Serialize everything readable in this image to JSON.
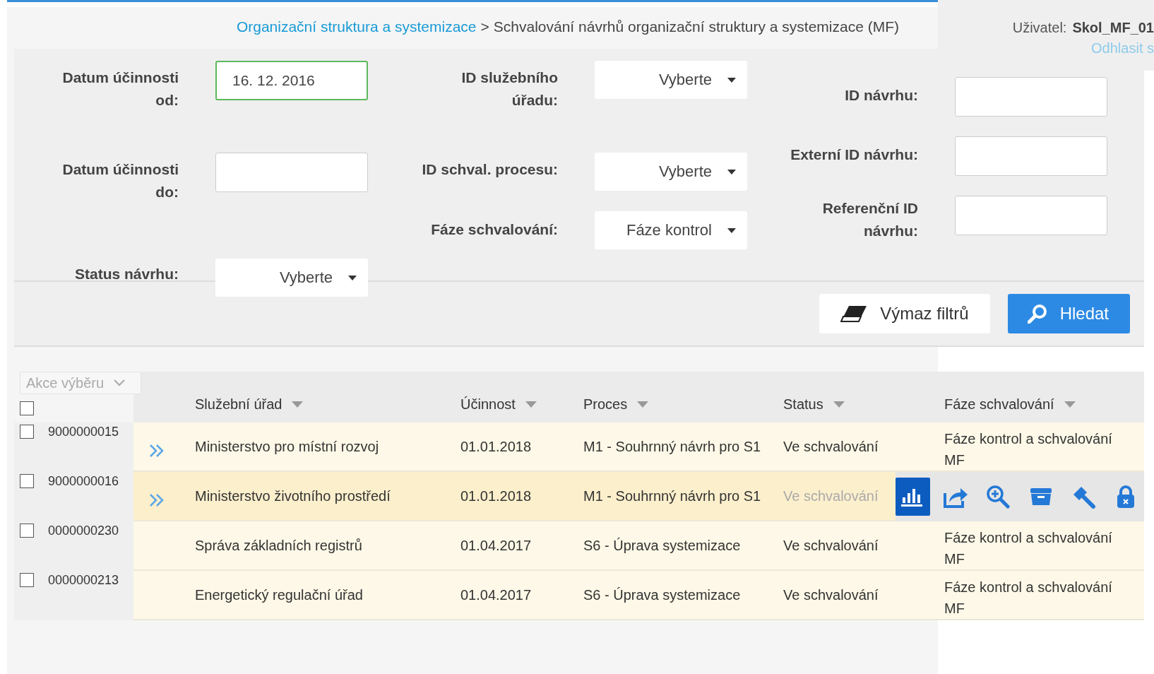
{
  "header": {
    "breadcrumb": {
      "link": "Organizační struktura a systemizace",
      "separator": ">",
      "current": "Schvalování návrhů organizační struktury a systemizace (MF)"
    },
    "user": {
      "label": "Uživatel:",
      "name": "Skol_MF_01",
      "logout": "Odhlasit s"
    }
  },
  "filters": {
    "columns": [
      {
        "fields": [
          {
            "kind": "date",
            "label": "Datum účinnosti od:",
            "value": "16. 12. 2016",
            "focused": true
          },
          {
            "kind": "date",
            "label": "Datum účinnosti do:",
            "focused": false
          },
          {
            "kind": "select",
            "label": "Status návrhu:",
            "value": "Vyberte"
          }
        ]
      },
      {
        "fields": [
          {
            "kind": "select",
            "label": "ID služebního úřadu:",
            "value": "Vyberte"
          },
          {
            "kind": "select",
            "label": "ID schval. procesu:",
            "value": "Vyberte"
          },
          {
            "kind": "select",
            "label": "Fáze schvalování:",
            "value": "Fáze kontrol"
          }
        ]
      },
      {
        "fields": [
          {
            "kind": "text",
            "label": "ID návrhu:",
            "focused": false
          },
          {
            "kind": "text",
            "label": "Externí ID návrhu:",
            "focused": false
          },
          {
            "kind": "text",
            "label": "Referenční ID návrhu:",
            "focused": false
          }
        ]
      }
    ],
    "buttons": [
      {
        "kind": "clear",
        "label": "Výmaz filtrů"
      },
      {
        "kind": "search",
        "label": "Hledat"
      }
    ]
  },
  "table": {
    "bulk_action": {
      "label": "Akce výběru",
      "disabled": true
    },
    "select_all": {
      "checked": false
    },
    "columns": [
      "Služební úřad",
      "Účinnost",
      "Proces",
      "Status",
      "Fáze schvalování"
    ],
    "rows": [
      {
        "id": "9000000015",
        "checked": false,
        "expandable": true,
        "hovered": false,
        "cells": [
          "Ministerstvo pro místní rozvoj",
          "01.01.2018",
          "M1 - Souhrnný návrh pro S1",
          "Ve schvalování",
          "Fáze kontrol a schvalování MF"
        ]
      },
      {
        "id": "9000000016",
        "checked": false,
        "expandable": true,
        "hovered": true,
        "cells": [
          "Ministerstvo životního prostředí",
          "01.01.2018",
          "M1 - Souhrnný návrh pro S1",
          "Ve schvalování"
        ],
        "actions": [
          {
            "kind": "chart",
            "selected": true
          },
          {
            "kind": "share",
            "selected": false
          },
          {
            "kind": "zoom",
            "selected": false
          },
          {
            "kind": "archive",
            "selected": false
          },
          {
            "kind": "hammer",
            "selected": false
          },
          {
            "kind": "lock",
            "selected": false
          }
        ]
      },
      {
        "id": "0000000230",
        "checked": false,
        "expandable": false,
        "hovered": false,
        "cells": [
          "Správa základních registrů",
          "01.04.2017",
          "S6 - Úprava systemizace",
          "Ve schvalování",
          "Fáze kontrol a schvalování MF"
        ]
      },
      {
        "id": "0000000213",
        "checked": false,
        "expandable": false,
        "hovered": false,
        "cells": [
          "Energetický regulační úřad",
          "01.04.2017",
          "S6 - Úprava systemizace",
          "Ve schvalování",
          "Fáze kontrol a schvalování MF"
        ]
      }
    ]
  }
}
